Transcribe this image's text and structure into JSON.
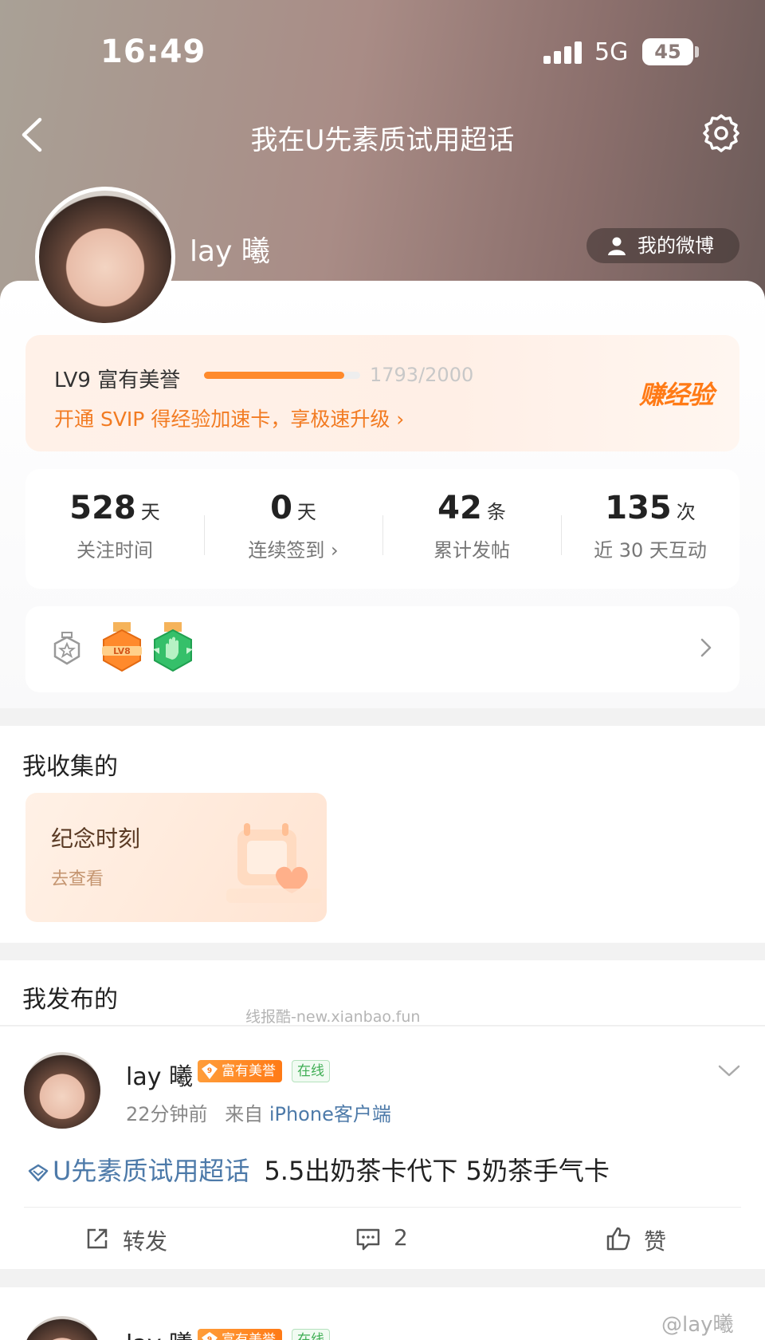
{
  "status_bar": {
    "time": "16:49",
    "network": "5G",
    "battery": "45"
  },
  "nav": {
    "title": "我在U先素质试用超话"
  },
  "profile": {
    "name": "lay 曦",
    "my_weibo_label": "我的微博"
  },
  "level": {
    "label": "LV9 富有美誉",
    "progress_text": "1793/2000",
    "progress_fraction": 0.8965,
    "promo": "开通 SVIP 得经验加速卡，享极速升级 ›",
    "earn_label": "赚经验"
  },
  "stats": [
    {
      "value": "528",
      "unit": "天",
      "label": "关注时间"
    },
    {
      "value": "0",
      "unit": "天",
      "label": "连续签到 ›"
    },
    {
      "value": "42",
      "unit": "条",
      "label": "累计发帖"
    },
    {
      "value": "135",
      "unit": "次",
      "label": "近 30 天互动"
    }
  ],
  "medals": [
    {
      "icon": "medal-outline-icon"
    },
    {
      "icon": "lv8-medal-icon",
      "text": "LV8",
      "color": "#ff8a2c"
    },
    {
      "icon": "hand-medal-icon",
      "color": "#35c06a"
    }
  ],
  "collected": {
    "title": "我收集的",
    "card_title": "纪念时刻",
    "card_link": "去查看"
  },
  "published": {
    "title": "我发布的",
    "watermark": "线报酷-new.xianbao.fun"
  },
  "post": {
    "author": "lay 曦",
    "badge_level": "9",
    "badge_fame": "富有美誉",
    "badge_online": "在线",
    "time": "22分钟前",
    "source_prefix": "来自",
    "client": "iPhone客户端",
    "topic": "U先素质试用超话",
    "content": "5.5出奶茶卡代下 5奶茶手气卡",
    "repost_label": "转发",
    "comment_count": "2",
    "like_label": "赞"
  },
  "post2": {
    "author": "lay 曦",
    "badge_level": "9",
    "badge_fame": "富有美誉",
    "badge_online": "在线"
  },
  "bottom_watermark": "@lay曦",
  "colors": {
    "accent_orange": "#ff7a16",
    "link_blue": "#4d7aa9",
    "online_green": "#3fae54"
  }
}
